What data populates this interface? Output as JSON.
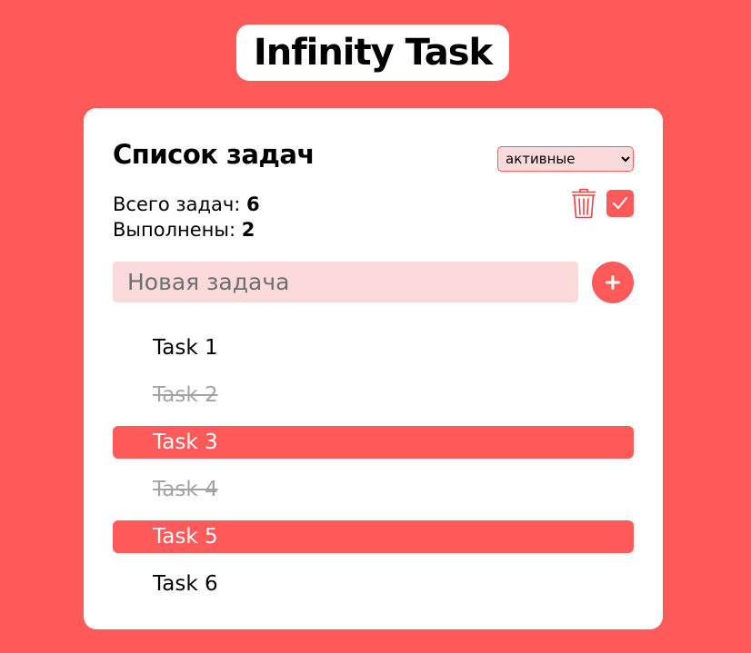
{
  "app": {
    "title": "Infinity Task"
  },
  "card": {
    "heading": "Список задач",
    "filter": {
      "selected": "активные",
      "options": [
        "активные"
      ]
    },
    "stats": {
      "total_label": "Всего задач: ",
      "total_value": "6",
      "done_label": "Выполнены: ",
      "done_value": "2"
    },
    "actions": {
      "delete_icon": "trash-icon",
      "check_icon": "checkmark-icon"
    },
    "new_task": {
      "placeholder": "Новая задача",
      "value": "",
      "add_label": "+"
    },
    "tasks": [
      {
        "label": "Task 1",
        "state": "normal"
      },
      {
        "label": "Task 2",
        "state": "done"
      },
      {
        "label": "Task 3",
        "state": "active"
      },
      {
        "label": "Task 4",
        "state": "done"
      },
      {
        "label": "Task 5",
        "state": "active"
      },
      {
        "label": "Task 6",
        "state": "normal"
      }
    ]
  },
  "colors": {
    "accent": "#ff5a5a",
    "input_bg": "#fadadb",
    "done_text": "#a3a3a3"
  }
}
